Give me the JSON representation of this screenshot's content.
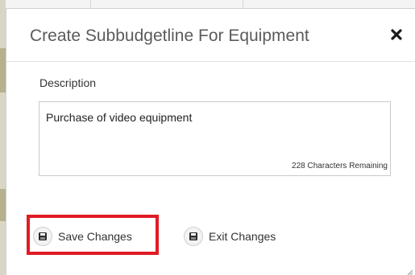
{
  "dialog": {
    "title": "Create Subbudgetline For Equipment",
    "close_icon": "close-icon"
  },
  "description": {
    "label": "Description",
    "value": "Purchase of video equipment",
    "remaining_text": "228 Characters Remaining"
  },
  "actions": {
    "save_label": "Save Changes",
    "save_icon": "floppy-disk-icon",
    "exit_label": "Exit Changes",
    "exit_icon": "floppy-disk-icon",
    "highlight_color": "#e01b24"
  }
}
